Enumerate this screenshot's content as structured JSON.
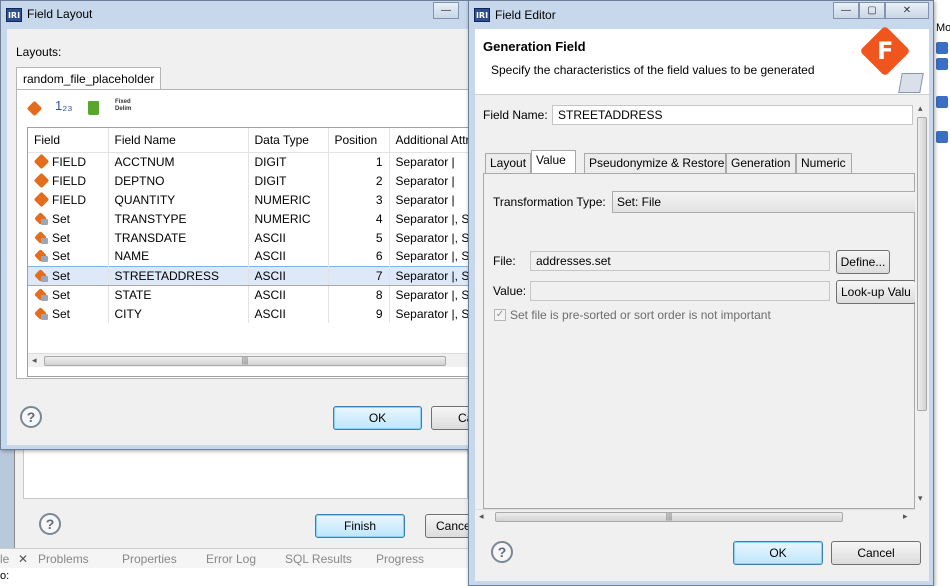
{
  "background": {
    "views": [
      "le",
      "Problems",
      "Properties",
      "Error Log",
      "SQL Results",
      "Progress"
    ],
    "status_label": "o:",
    "finish_label": "Finish",
    "cancel_label": "Cance",
    "side_label": "Mo"
  },
  "field_layout": {
    "title": "Field Layout",
    "layouts_label": "Layouts:",
    "tab": "random_file_placeholder",
    "toolbar": {
      "fixed_label_1": "Fixed",
      "fixed_label_2": "Delim",
      "num_label": "1₂₃"
    },
    "columns": [
      "Field",
      "Field Name",
      "Data Type",
      "Position",
      "Additional Attri"
    ],
    "rows": [
      {
        "field": "FIELD",
        "name": "ACCTNUM",
        "type": "DIGIT",
        "pos": "1",
        "attr": "Separator |"
      },
      {
        "field": "FIELD",
        "name": "DEPTNO",
        "type": "DIGIT",
        "pos": "2",
        "attr": "Separator |"
      },
      {
        "field": "FIELD",
        "name": "QUANTITY",
        "type": "NUMERIC",
        "pos": "3",
        "attr": "Separator |"
      },
      {
        "field": "Set",
        "name": "TRANSTYPE",
        "type": "NUMERIC",
        "pos": "4",
        "attr": "Separator |, Set"
      },
      {
        "field": "Set",
        "name": "TRANSDATE",
        "type": "ASCII",
        "pos": "5",
        "attr": "Separator |, Set"
      },
      {
        "field": "Set",
        "name": "NAME",
        "type": "ASCII",
        "pos": "6",
        "attr": "Separator |, Set"
      },
      {
        "field": "Set",
        "name": "STREETADDRESS",
        "type": "ASCII",
        "pos": "7",
        "attr": "Separator |, Set"
      },
      {
        "field": "Set",
        "name": "STATE",
        "type": "ASCII",
        "pos": "8",
        "attr": "Separator |, Set"
      },
      {
        "field": "Set",
        "name": "CITY",
        "type": "ASCII",
        "pos": "9",
        "attr": "Separator |, Set"
      }
    ],
    "selected_row": 6,
    "help": "?",
    "ok_label": "OK",
    "cancel_label": "Ca"
  },
  "field_editor": {
    "title": "Field Editor",
    "header_title": "Generation Field",
    "header_desc": "Specify the characteristics of the field values to be generated",
    "logo_letter": "F",
    "field_name_label": "Field Name:",
    "field_name_value": "STREETADDRESS",
    "tabs": [
      "Layout",
      "Value",
      "Pseudonymize & Restore",
      "Generation",
      "Numeric"
    ],
    "active_tab": "Value",
    "transformation_type_label": "Transformation Type:",
    "transformation_type_value": "Set: File",
    "file_label": "File:",
    "file_value": "addresses.set",
    "define_label": "Define...",
    "value_label": "Value:",
    "value_value": "",
    "lookup_label": "Look-up Valu",
    "checkbox_label": "Set file is pre-sorted or sort order is not important",
    "checkbox_checked": true,
    "help": "?",
    "ok_label": "OK",
    "cancel_label": "Cancel"
  },
  "colors": {
    "accent": "#e36d1c",
    "titlebar": "#c7d8ec",
    "selection": "#dde9f8"
  }
}
